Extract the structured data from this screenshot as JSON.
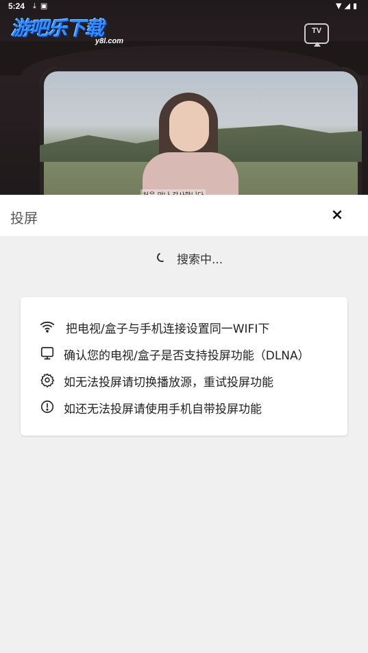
{
  "status_bar": {
    "time": "5:24",
    "left_icons": [
      "download-icon",
      "a-icon"
    ],
    "right_icons": [
      "wifi-icon",
      "signal-icon",
      "battery-icon"
    ]
  },
  "video": {
    "logo_title": "游吧乐下载",
    "logo_sub": "y8l.com",
    "subtitle_text": "처음 만나 감사합니다",
    "tv_button_label": "TV"
  },
  "sheet": {
    "title": "投屏",
    "close_icon": "×"
  },
  "search": {
    "status_text": "搜索中..."
  },
  "tips": [
    {
      "icon": "wifi-icon",
      "text": "把电视/盒子与手机连接设置同一WIFI下"
    },
    {
      "icon": "monitor-icon",
      "text": "确认您的电视/盒子是否支持投屏功能（DLNA）"
    },
    {
      "icon": "gear-icon",
      "text": "如无法投屏请切换播放源，重试投屏功能"
    },
    {
      "icon": "alert-circle-icon",
      "text": "如还无法投屏请使用手机自带投屏功能"
    }
  ],
  "colors": {
    "logo_blue": "#2f8bff",
    "sheet_bg": "#ffffff",
    "page_bg": "#f0f0f0"
  }
}
